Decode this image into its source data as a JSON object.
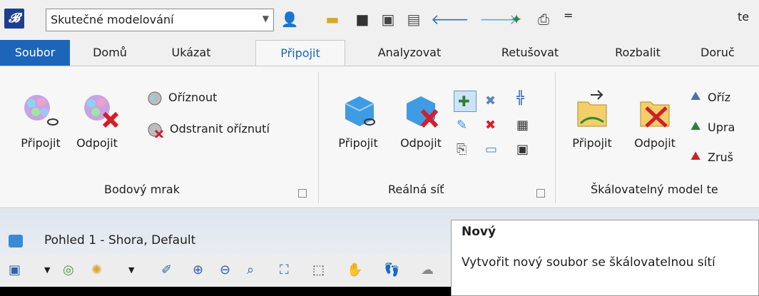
{
  "quick_access": {
    "workspace": "Skutečné modelování",
    "overflow_glyph": "=",
    "title_fragment": "te"
  },
  "tabs": {
    "file": "Soubor",
    "items": [
      "Domů",
      "Ukázat",
      "Připojit",
      "Analyzovat",
      "Retušovat",
      "Rozbalit",
      "Doruč"
    ],
    "active": "Připojit"
  },
  "ribbon": {
    "point_cloud": {
      "title": "Bodový mrak",
      "attach": "Připojit",
      "detach": "Odpojit",
      "clip": "Oříznout",
      "remove_clip": "Odstranit oříznutí"
    },
    "reality_mesh": {
      "title": "Reálná síť",
      "attach": "Připojit",
      "detach": "Odpojit"
    },
    "scalable_terrain": {
      "title": "Škálovatelný model te",
      "attach": "Připojit",
      "detach": "Odpojit",
      "clip": "Oříz",
      "edit": "Upra",
      "cancel": "Zruš"
    }
  },
  "view": {
    "title": "Pohled 1 - Shora, Default"
  },
  "tooltip": {
    "title": "Nový",
    "description": "Vytvořit nový soubor se škálovatelnou sítí"
  },
  "colors": {
    "accent": "#1d65b8",
    "file_tab": "#1d65b8",
    "detach_x": "#d21f2a"
  }
}
